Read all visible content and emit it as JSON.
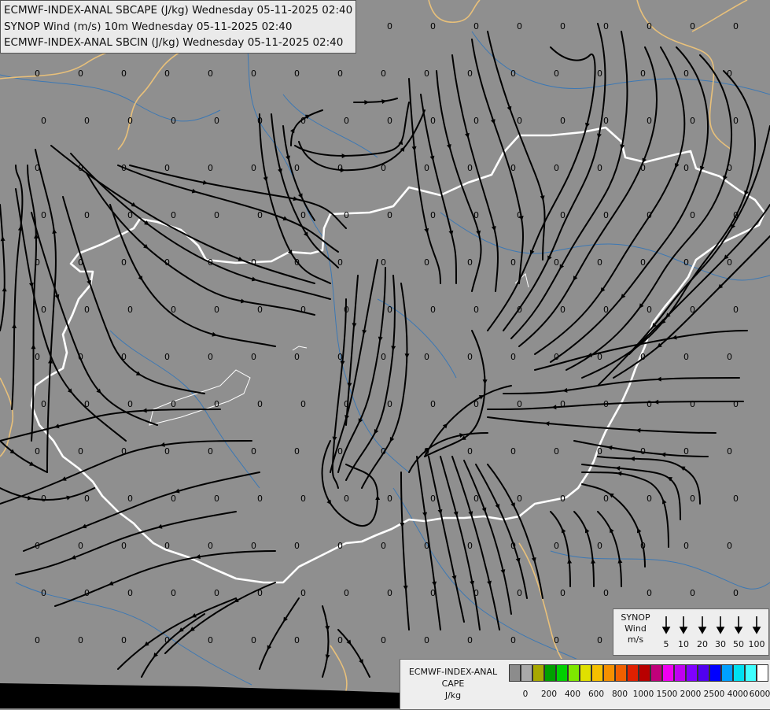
{
  "titles": [
    "ECMWF-INDEX-ANAL SBCAPE (J/kg) Wednesday 05-11-2025 02:40",
    "SYNOP Wind (m/s) 10m Wednesday 05-11-2025 02:40",
    "ECMWF-INDEX-ANAL SBCIN (J/kg) Wednesday 05-11-2025 02:40"
  ],
  "grid_value": "0",
  "synop_legend": {
    "title_line1": "SYNOP",
    "title_line2": "Wind",
    "unit": "m/s",
    "values": [
      "5",
      "10",
      "20",
      "30",
      "50",
      "100"
    ]
  },
  "cape_legend": {
    "title_line1": "ECMWF-INDEX-ANAL",
    "title_line2": "CAPE",
    "unit": "J/kg",
    "colors": [
      "#8c8c8c",
      "#a9a9a9",
      "#a8a800",
      "#00a000",
      "#00d000",
      "#7ee800",
      "#e0e000",
      "#f5c000",
      "#f59000",
      "#f06000",
      "#e02000",
      "#b80000",
      "#c0007a",
      "#f000f0",
      "#c000f0",
      "#8000ff",
      "#5000f0",
      "#0000ff",
      "#00a0ff",
      "#00e0f0",
      "#40ffff",
      "#ffffff"
    ],
    "ticks": [
      "0",
      "200",
      "400",
      "600",
      "800",
      "1000",
      "1500",
      "2000",
      "2500",
      "4000",
      "6000"
    ]
  },
  "colors": {
    "background": "#8f8f8f",
    "country_border": "#ffffff",
    "region_border": "#e8c07a",
    "rivers": "#3c78b4",
    "streamlines": "#000000"
  }
}
